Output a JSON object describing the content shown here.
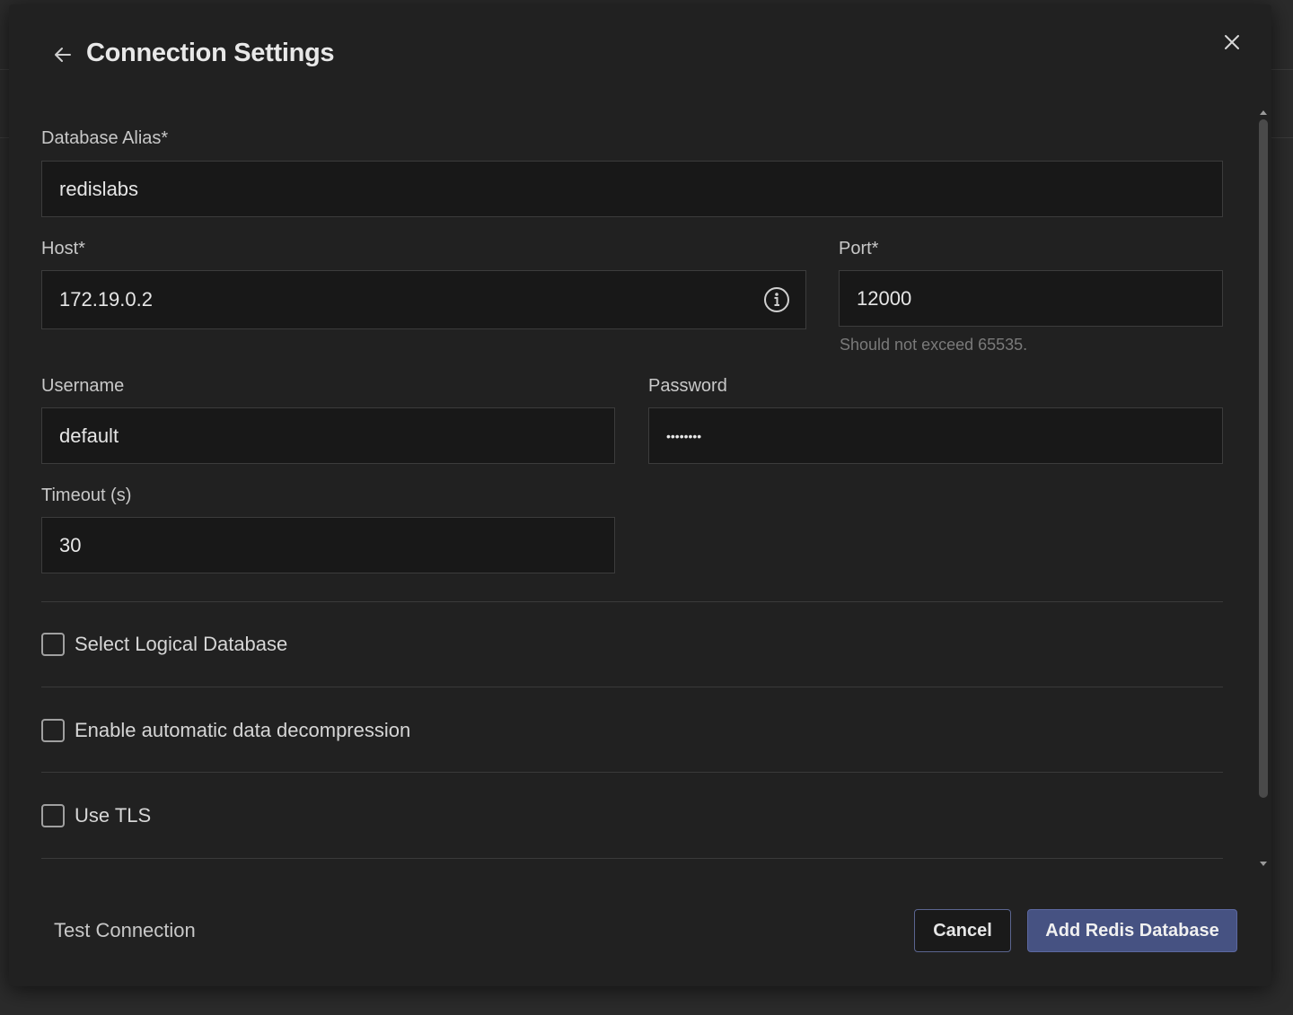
{
  "modal": {
    "title": "Connection Settings"
  },
  "form": {
    "alias_label": "Database Alias*",
    "alias_value": "redislabs",
    "host_label": "Host*",
    "host_value": "172.19.0.2",
    "port_label": "Port*",
    "port_value": "12000",
    "port_helper": "Should not exceed 65535.",
    "username_label": "Username",
    "username_value": "default",
    "password_label": "Password",
    "password_value": "••••••••",
    "timeout_label": "Timeout (s)",
    "timeout_value": "30"
  },
  "options": {
    "logical_db_label": "Select Logical Database",
    "logical_db_checked": false,
    "decompression_label": "Enable automatic data decompression",
    "decompression_checked": false,
    "tls_label": "Use TLS",
    "tls_checked": false
  },
  "footer": {
    "test_connection_label": "Test Connection",
    "cancel_label": "Cancel",
    "submit_label": "Add Redis Database"
  },
  "icons": {
    "back": "arrow-left-icon",
    "close": "close-icon",
    "info": "info-icon"
  },
  "colors": {
    "modal_bg": "#212121",
    "input_bg": "#181818",
    "primary_button": "#465282",
    "cancel_border": "#5b6590"
  }
}
